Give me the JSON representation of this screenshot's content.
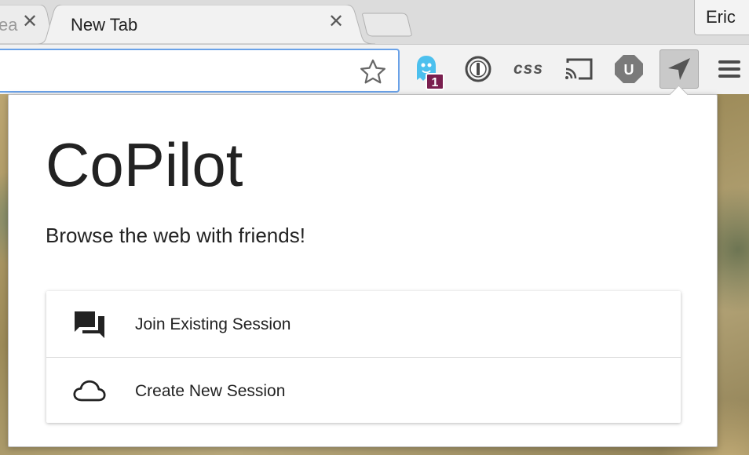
{
  "tabs": [
    {
      "title": "ea",
      "state": "background"
    },
    {
      "title": "New Tab",
      "state": "active"
    }
  ],
  "profile": {
    "name": "Eric"
  },
  "omnibox": {
    "value": ""
  },
  "extensions": [
    {
      "name": "ghostery-icon",
      "badge": "1"
    },
    {
      "name": "1password-icon"
    },
    {
      "name": "css-extension-icon",
      "label": "css"
    },
    {
      "name": "cast-icon"
    },
    {
      "name": "ublock-icon",
      "label": "U"
    },
    {
      "name": "copilot-icon",
      "active": true
    },
    {
      "name": "chrome-menu-icon"
    }
  ],
  "popup": {
    "title": "CoPilot",
    "subtitle": "Browse the web with friends!",
    "actions": [
      {
        "label": "Join Existing Session",
        "icon": "chat-bubbles-icon"
      },
      {
        "label": "Create New Session",
        "icon": "cloud-icon"
      }
    ]
  },
  "colors": {
    "omnibox_focus": "#6aa2e8",
    "ghostery": "#4cc0ee",
    "badge": "#7a1f4f"
  }
}
